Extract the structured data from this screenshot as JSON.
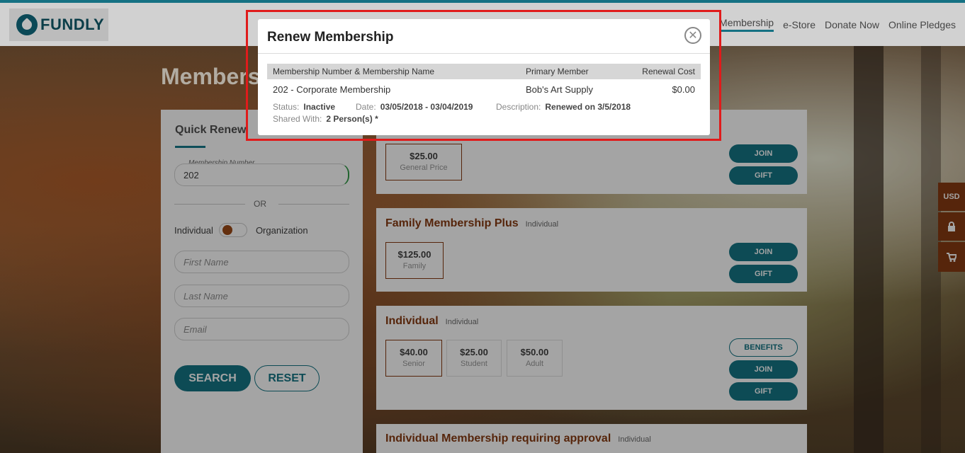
{
  "header": {
    "logo_text": "FUNDLY",
    "nav": [
      "Membership",
      "e-Store",
      "Donate Now",
      "Online Pledges"
    ]
  },
  "page": {
    "title": "Membership"
  },
  "sidebar": {
    "heading": "Quick Renew",
    "membership_number_label": "Membership Number",
    "membership_number_value": "202",
    "or_text": "OR",
    "toggle_left": "Individual",
    "toggle_right": "Organization",
    "first_name_placeholder": "First Name",
    "last_name_placeholder": "Last Name",
    "email_placeholder": "Email",
    "search_label": "SEARCH",
    "reset_label": "RESET"
  },
  "cards": [
    {
      "title": "",
      "subtitle": "",
      "prices": [
        {
          "amount": "$25.00",
          "label": "General Price"
        }
      ],
      "buttons": [
        "JOIN",
        "GIFT"
      ]
    },
    {
      "title": "Family Membership Plus",
      "subtitle": "Individual",
      "prices": [
        {
          "amount": "$125.00",
          "label": "Family"
        }
      ],
      "buttons": [
        "JOIN",
        "GIFT"
      ]
    },
    {
      "title": "Individual",
      "subtitle": "Individual",
      "prices": [
        {
          "amount": "$40.00",
          "label": "Senior"
        },
        {
          "amount": "$25.00",
          "label": "Student"
        },
        {
          "amount": "$50.00",
          "label": "Adult"
        }
      ],
      "buttons": [
        "BENEFITS",
        "JOIN",
        "GIFT"
      ]
    },
    {
      "title": "Individual Membership requiring approval",
      "subtitle": "Individual",
      "prices": [],
      "buttons": []
    }
  ],
  "side_tabs": [
    "USD"
  ],
  "modal": {
    "title": "Renew Membership",
    "close_symbol": "✕",
    "columns": [
      "Membership Number & Membership Name",
      "Primary Member",
      "Renewal Cost"
    ],
    "row": {
      "membership": "202 - Corporate Membership",
      "primary_member": "Bob's Art Supply",
      "renewal_cost": "$0.00"
    },
    "status_label": "Status:",
    "status_value": "Inactive",
    "date_label": "Date:",
    "date_value": "03/05/2018 - 03/04/2019",
    "description_label": "Description:",
    "description_value": "Renewed on 3/5/2018",
    "shared_label": "Shared With:",
    "shared_value": "2 Person(s) *"
  },
  "colors": {
    "accent_teal": "#105c68",
    "accent_brown": "#6a2e0e",
    "highlight_red": "#e01b1b"
  }
}
